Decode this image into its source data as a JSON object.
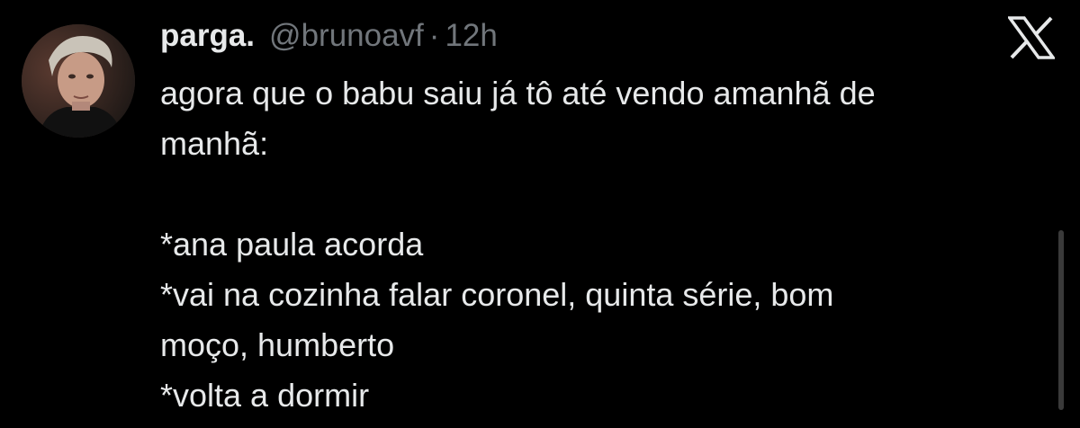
{
  "tweet": {
    "display_name": "parga.",
    "handle": "@brunoavf",
    "separator": "·",
    "time": "12h",
    "lines": [
      "agora que o babu saiu já tô até vendo amanhã de",
      "manhã:",
      "",
      "*ana paula acorda",
      "*vai na cozinha falar coronel, quinta série, bom",
      "moço, humberto",
      "*volta a dormir"
    ]
  },
  "icons": {
    "brand": "x-logo-icon"
  },
  "colors": {
    "background": "#000000",
    "primary_text": "#e7e9ea",
    "secondary_text": "#71767b"
  }
}
